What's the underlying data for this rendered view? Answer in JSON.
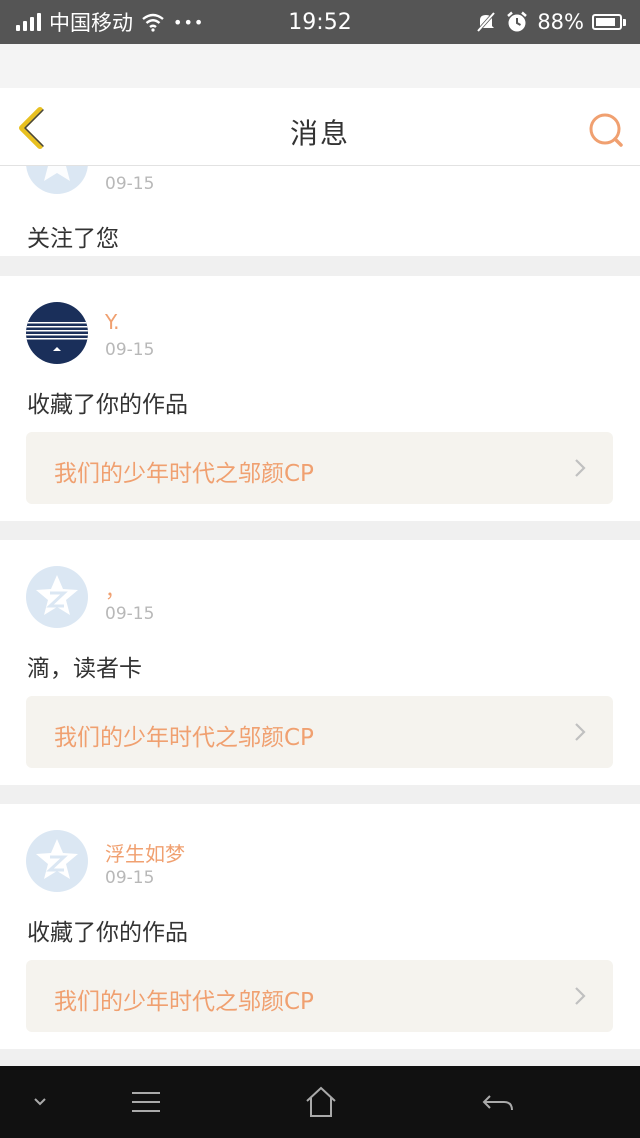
{
  "status_bar": {
    "carrier": "中国移动",
    "dots": "•••",
    "time": "19:52",
    "battery": "88%",
    "battery_level": 0.88
  },
  "header": {
    "title": "消息",
    "back_icon": "chevron-left-icon",
    "search_icon": "search-icon",
    "accent_color": "#f0a070",
    "back_color": "#e8c020"
  },
  "messages": [
    {
      "username": "",
      "date": "09-15",
      "action": "关注了您",
      "work": ""
    },
    {
      "username": "Y.",
      "date": "09-15",
      "action": "收藏了你的作品",
      "work": "我们的少年时代之邬颜CP"
    },
    {
      "username": "，",
      "date": "09-15",
      "action": "滴，读者卡",
      "work": "我们的少年时代之邬颜CP"
    },
    {
      "username": "浮生如梦",
      "date": "09-15",
      "action": "收藏了你的作品",
      "work": "我们的少年时代之邬颜CP"
    }
  ],
  "nav": {
    "icons": [
      "chevron-down-icon",
      "menu-icon",
      "home-icon",
      "back-arrow-icon"
    ]
  }
}
